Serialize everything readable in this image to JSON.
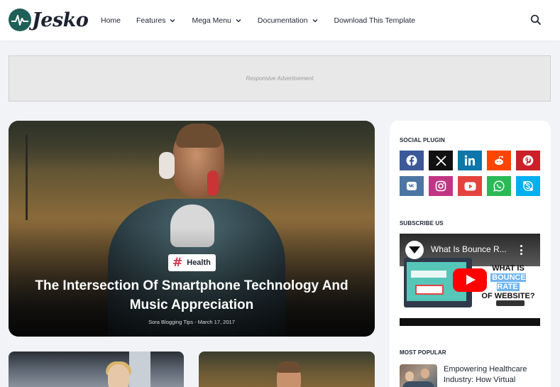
{
  "brand": {
    "name": "Jesko",
    "logo_color": "#1f5f58"
  },
  "nav": {
    "items": [
      {
        "label": "Home",
        "has_dropdown": false
      },
      {
        "label": "Features",
        "has_dropdown": true
      },
      {
        "label": "Mega Menu",
        "has_dropdown": true
      },
      {
        "label": "Documentation",
        "has_dropdown": true
      },
      {
        "label": "Download This Template",
        "has_dropdown": false
      }
    ],
    "search_icon": "search-icon"
  },
  "ad": {
    "text": "Responsive Advertisement"
  },
  "featured": {
    "tag": "Health",
    "tag_symbol": "#",
    "tag_color": "#d2354b",
    "title": "The Intersection Of Smartphone Technology And Music Appreciation",
    "meta": "Sora Blogging Tips - March 17, 2017"
  },
  "sidebar": {
    "social_title": "SOCIAL PLUGIN",
    "social": [
      {
        "name": "facebook",
        "color": "#3b5998"
      },
      {
        "name": "x-twitter",
        "color": "#111111"
      },
      {
        "name": "linkedin",
        "color": "#0e76a8"
      },
      {
        "name": "reddit",
        "color": "#ff4500"
      },
      {
        "name": "pinterest",
        "color": "#cb2027"
      },
      {
        "name": "vk",
        "color": "#4c75a3"
      },
      {
        "name": "instagram",
        "color": "#c13584"
      },
      {
        "name": "youtube",
        "color": "#e4433d"
      },
      {
        "name": "whatsapp",
        "color": "#2ab955"
      },
      {
        "name": "skype",
        "color": "#00aff0"
      }
    ],
    "subscribe_title": "SUBSCRIBE US",
    "video": {
      "title": "What Is Bounce R...",
      "thumb_line1": "WHAT IS",
      "thumb_line2": "BOUNCE RATE",
      "thumb_line3": "OF WEBSITE?"
    },
    "popular_title": "MOST POPULAR",
    "popular": [
      {
        "title": "Empowering Healthcare Industry: How Virtual"
      }
    ]
  }
}
